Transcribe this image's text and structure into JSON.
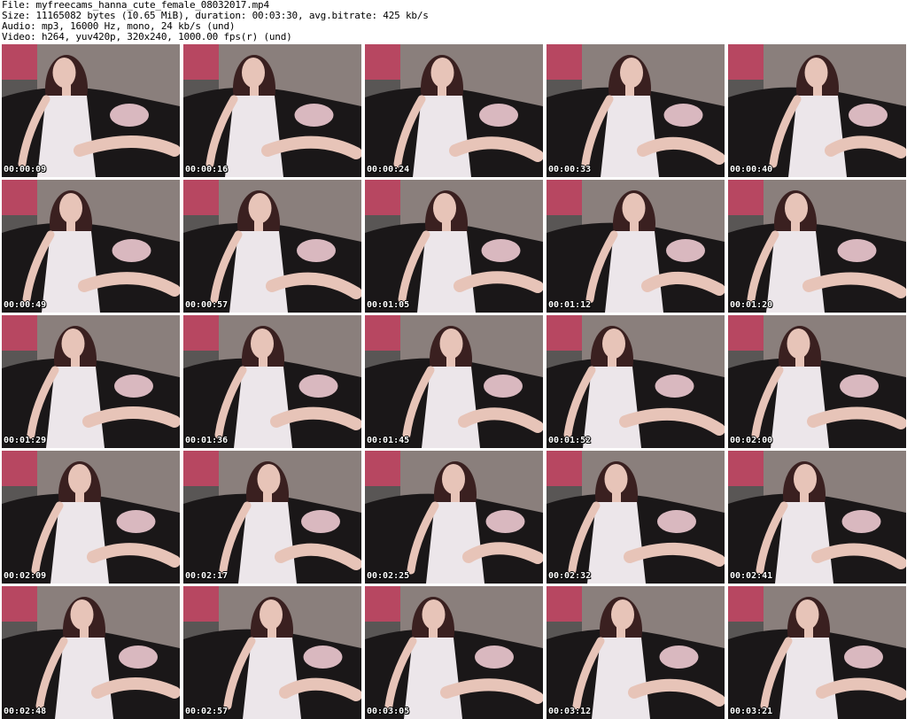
{
  "header": {
    "file": "File: myfreecams_hanna_cute_female_08032017.mp4",
    "size": "Size: 11165082 bytes (10.65 MiB), duration: 00:03:30, avg.bitrate: 425 kb/s",
    "audio": "Audio: mp3, 16000 Hz, mono, 24 kb/s (und)",
    "video": "Video: h264, yuv420p, 320x240, 1000.00 fps(r) (und)"
  },
  "thumbnails": [
    {
      "time": "00:00:09"
    },
    {
      "time": "00:00:16"
    },
    {
      "time": "00:00:24"
    },
    {
      "time": "00:00:33"
    },
    {
      "time": "00:00:40"
    },
    {
      "time": "00:00:49"
    },
    {
      "time": "00:00:57"
    },
    {
      "time": "00:01:05"
    },
    {
      "time": "00:01:12"
    },
    {
      "time": "00:01:20"
    },
    {
      "time": "00:01:29"
    },
    {
      "time": "00:01:36"
    },
    {
      "time": "00:01:45"
    },
    {
      "time": "00:01:52"
    },
    {
      "time": "00:02:00"
    },
    {
      "time": "00:02:09"
    },
    {
      "time": "00:02:17"
    },
    {
      "time": "00:02:25"
    },
    {
      "time": "00:02:32"
    },
    {
      "time": "00:02:41"
    },
    {
      "time": "00:02:48"
    },
    {
      "time": "00:02:57"
    },
    {
      "time": "00:03:05"
    },
    {
      "time": "00:03:12"
    },
    {
      "time": "00:03:21"
    }
  ],
  "colors": {
    "wall": "#8a7f7c",
    "sofa": "#1a1718",
    "pillow": "#d9b8bf",
    "curtain": "#c23a5a",
    "dress": "#ece6ea",
    "skin": "#e7c4b8",
    "hair": "#3a2020"
  }
}
